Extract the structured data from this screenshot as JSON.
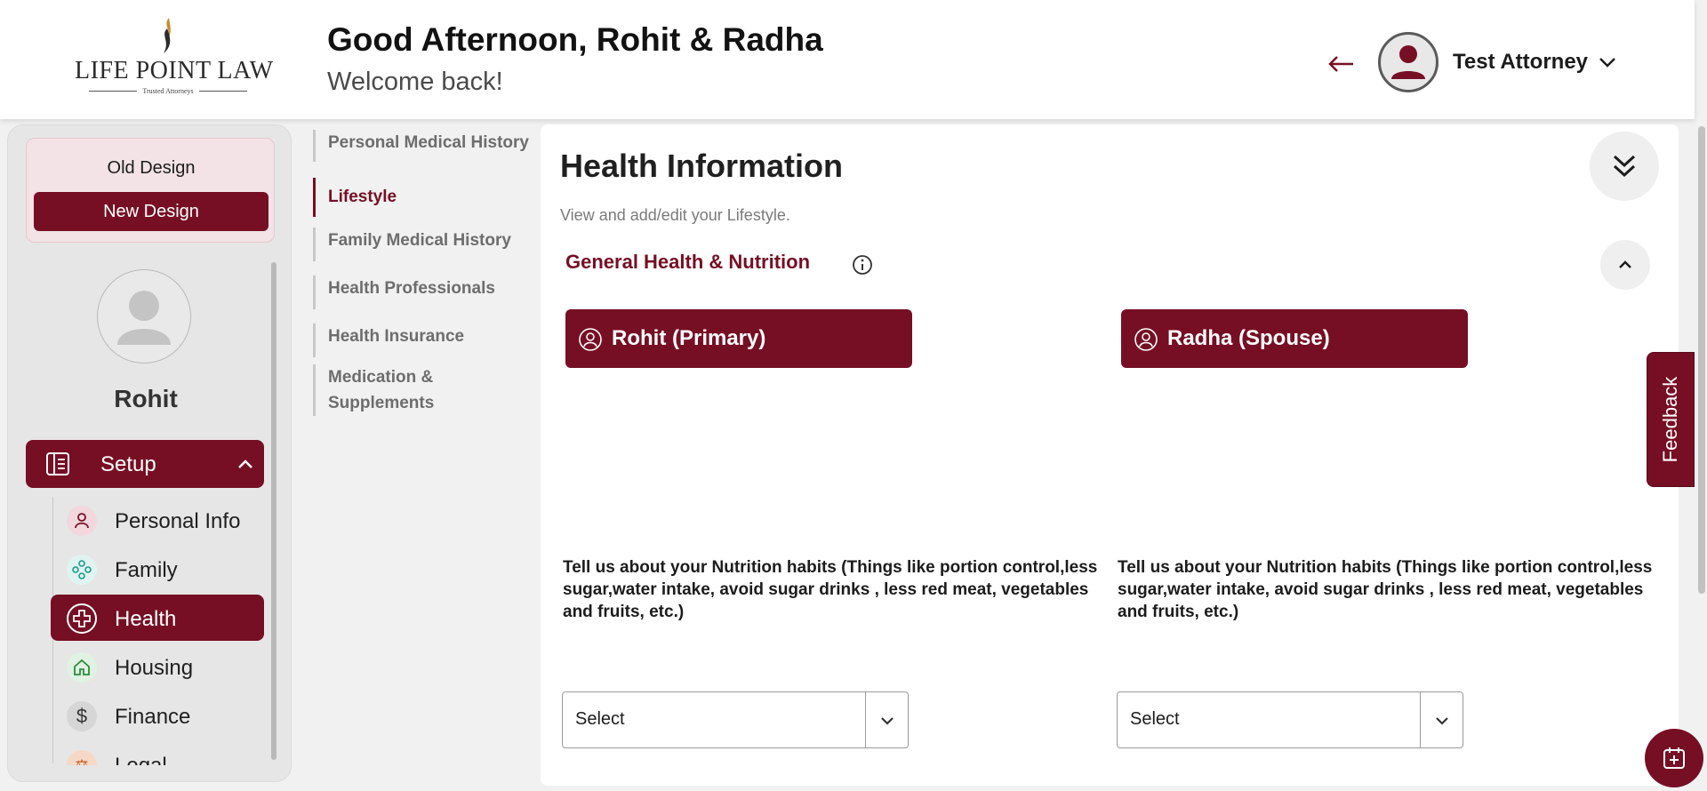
{
  "header": {
    "logo_text": "LIFE POINT LAW",
    "logo_tagline": "Trusted Attorneys",
    "greeting": "Good Afternoon, Rohit & Radha",
    "welcome": "Welcome back!",
    "user_name": "Test Attorney"
  },
  "sidebar": {
    "old_design_label": "Old Design",
    "new_design_label": "New Design",
    "profile_name": "Rohit",
    "setup_label": "Setup",
    "items": [
      {
        "label": "Personal Info",
        "icon": "person-icon"
      },
      {
        "label": "Family",
        "icon": "family-icon"
      },
      {
        "label": "Health",
        "icon": "health-plus-icon",
        "active": true
      },
      {
        "label": "Housing",
        "icon": "house-icon"
      },
      {
        "label": "Finance",
        "icon": "dollar-icon"
      },
      {
        "label": "Legal",
        "icon": "legal-icon"
      }
    ]
  },
  "subnav": {
    "items": [
      {
        "label": "Personal Medical History"
      },
      {
        "label": "Lifestyle",
        "active": true
      },
      {
        "label": "Family Medical History"
      },
      {
        "label": "Health Professionals"
      },
      {
        "label": "Health Insurance"
      },
      {
        "label": "Medication & Supplements"
      }
    ]
  },
  "main": {
    "title": "Health Information",
    "subtitle": "View and add/edit your Lifestyle.",
    "section_title": "General Health & Nutrition",
    "people": [
      {
        "label": "Rohit (Primary)",
        "question": "Tell us about your Nutrition habits (Things like portion control,less sugar,water intake, avoid sugar drinks , less red meat, vegetables and fruits, etc.)",
        "select_value": "Select"
      },
      {
        "label": "Radha (Spouse)",
        "question": "Tell us about your Nutrition habits (Things like portion control,less sugar,water intake, avoid sugar drinks , less red meat, vegetables and fruits, etc.)",
        "select_value": "Select"
      }
    ]
  },
  "feedback_label": "Feedback",
  "colors": {
    "brand": "#760f24",
    "background": "#f1f1f1",
    "panel": "#ffffff"
  }
}
